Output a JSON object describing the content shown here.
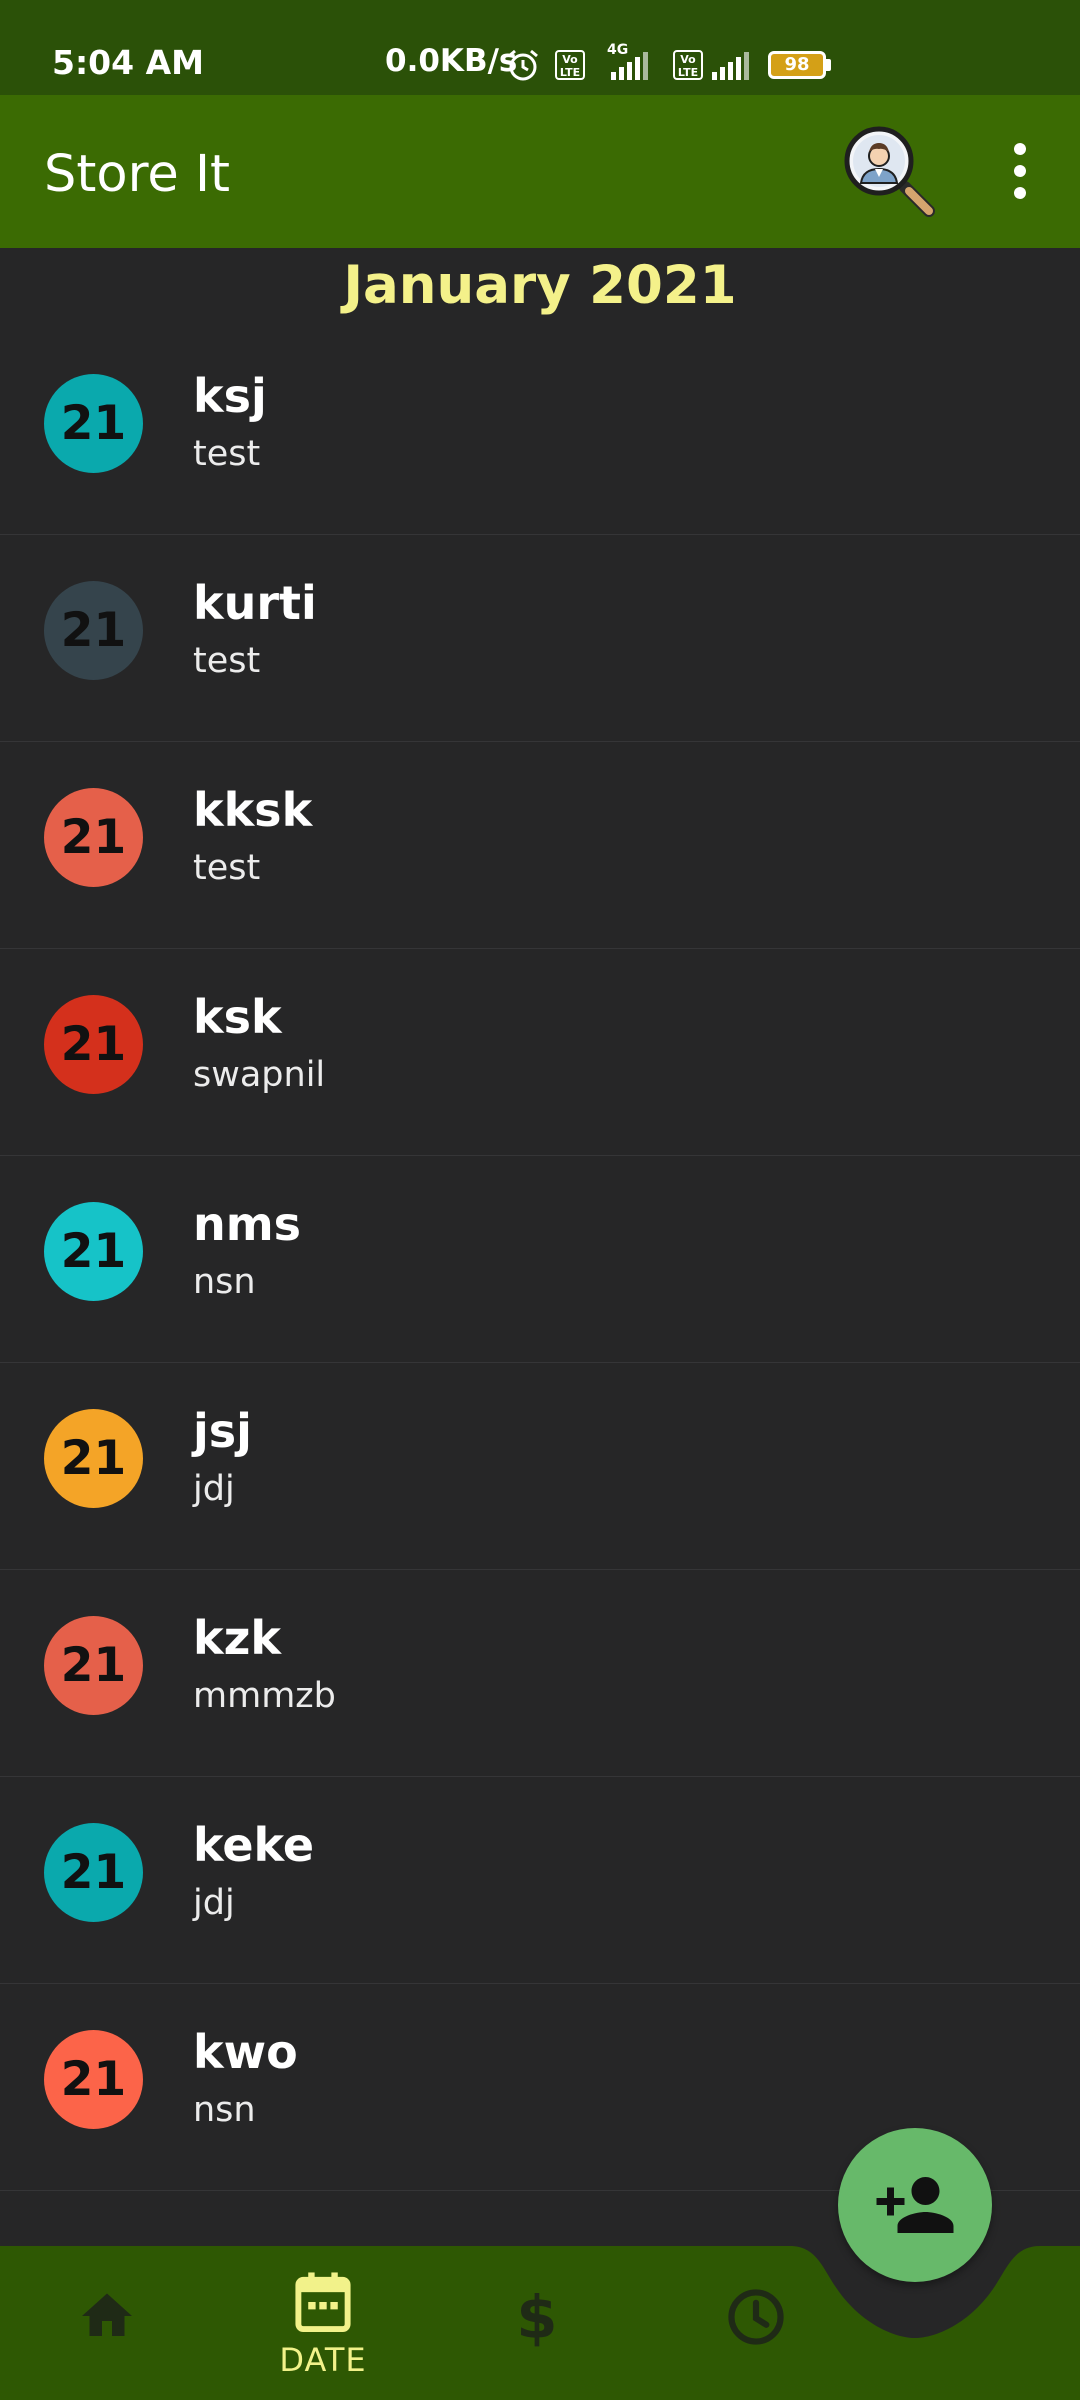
{
  "status_bar": {
    "time": "5:04 AM",
    "net_speed": "0.0KB/s",
    "volte_1": "Vo LTE",
    "network_type": "4G",
    "volte_2": "Vo LTE",
    "battery": "98"
  },
  "app_bar": {
    "title": "Store It",
    "search_icon": "user-search-icon",
    "menu_icon": "more-vert-icon"
  },
  "section": {
    "header": "January 2021"
  },
  "entries": [
    {
      "day": "21",
      "title": "ksj",
      "subtitle": "test",
      "color": "#0aa9ad"
    },
    {
      "day": "21",
      "title": "kurti",
      "subtitle": "test",
      "color": "#35444c"
    },
    {
      "day": "21",
      "title": "kksk",
      "subtitle": "test",
      "color": "#e5604a"
    },
    {
      "day": "21",
      "title": "ksk",
      "subtitle": "swapnil",
      "color": "#d4301c"
    },
    {
      "day": "21",
      "title": "nms",
      "subtitle": "nsn",
      "color": "#16c3c8"
    },
    {
      "day": "21",
      "title": "jsj",
      "subtitle": "jdj",
      "color": "#f4a427"
    },
    {
      "day": "21",
      "title": "kzk",
      "subtitle": "mmmzb",
      "color": "#e5604a"
    },
    {
      "day": "21",
      "title": "keke",
      "subtitle": "jdj",
      "color": "#0aa9ad"
    },
    {
      "day": "21",
      "title": "kwo",
      "subtitle": "nsn",
      "color": "#fc6449"
    }
  ],
  "bottom_nav": {
    "items": [
      {
        "icon": "home-icon",
        "label": ""
      },
      {
        "icon": "calendar-icon",
        "label": "DATE"
      },
      {
        "icon": "dollar-icon",
        "label": ""
      },
      {
        "icon": "clock-icon",
        "label": ""
      }
    ]
  },
  "fab": {
    "icon": "add-person-icon"
  },
  "colors": {
    "status_bar": "#2b5108",
    "app_bar": "#3b6b03",
    "bottom_nav": "#2e5803",
    "background": "#262627",
    "accent": "#f4f18a",
    "fab": "#67b96a"
  }
}
